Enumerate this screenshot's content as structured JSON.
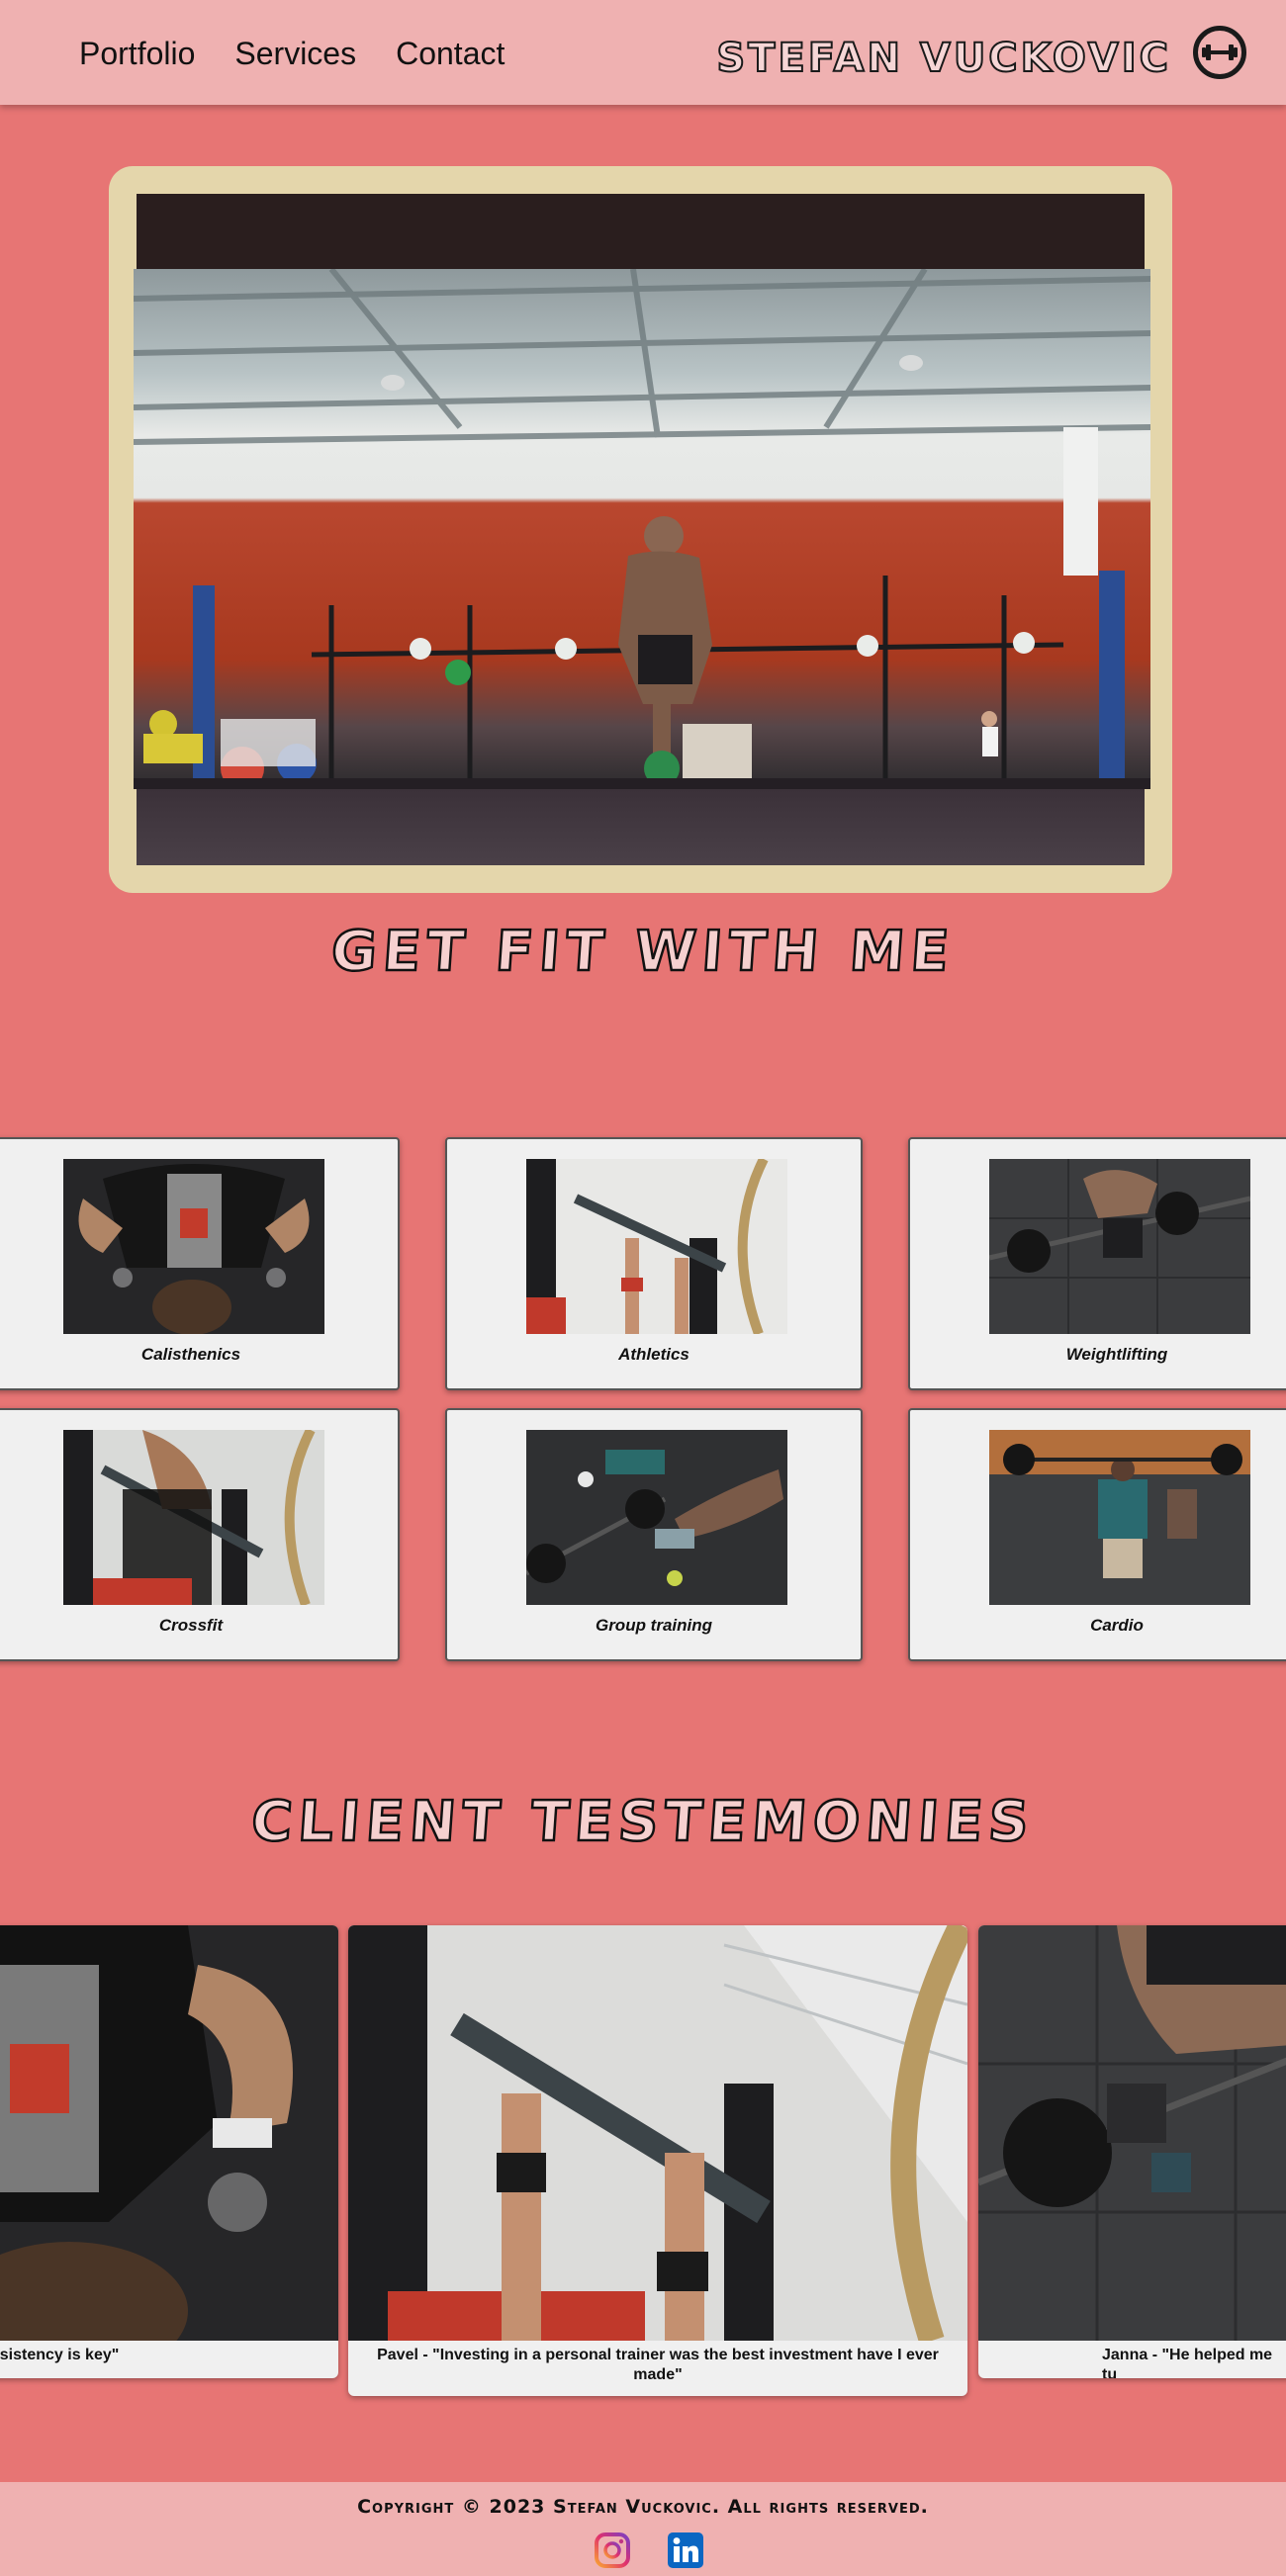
{
  "nav": {
    "links": [
      "Portfolio",
      "Services",
      "Contact"
    ],
    "brand": "STEFAN VUCKOVIC",
    "logo_icon": "dumbbell-icon"
  },
  "hero": {
    "image": "gym-kettlebell-photo",
    "title": "GET FIT WITH ME"
  },
  "services": {
    "items": [
      {
        "label": "Calisthenics",
        "image": "pushup-photo"
      },
      {
        "label": "Athletics",
        "image": "rack-photo"
      },
      {
        "label": "Weightlifting",
        "image": "deadlift-photo"
      },
      {
        "label": "Crossfit",
        "image": "rope-photo"
      },
      {
        "label": "Group training",
        "image": "group-floor-photo"
      },
      {
        "label": "Cardio",
        "image": "gym-floor-photo"
      }
    ]
  },
  "testimonials": {
    "title": "CLIENT TESTEMONIES",
    "items": [
      {
        "text": "nsistency is key\""
      },
      {
        "text": "Pavel - \"Investing in a personal trainer was the best investment have I ever made\""
      },
      {
        "text": "Janna - \"He helped me tu"
      }
    ]
  },
  "footer": {
    "copyright": "Copyright © 2023 Stefan Vuckovic. All rights reserved.",
    "social": [
      "instagram-icon",
      "linkedin-icon"
    ]
  },
  "colors": {
    "background": "#e77574",
    "nav": "#efb1b1",
    "hero_frame": "#e4d6ab",
    "card": "#f0f0f0"
  }
}
